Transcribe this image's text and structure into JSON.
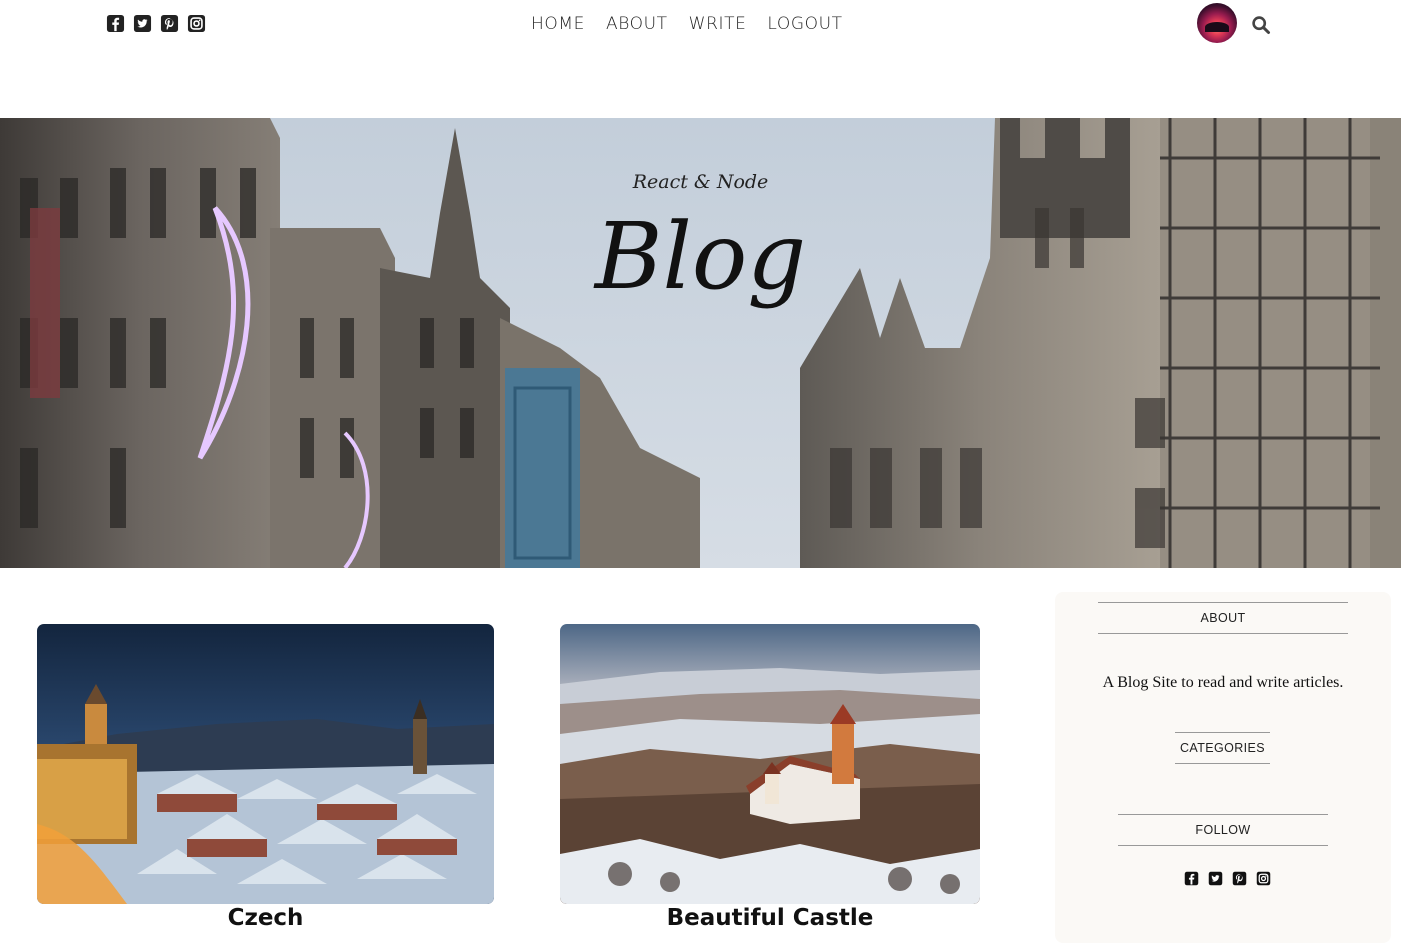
{
  "nav": {
    "items": [
      {
        "label": "HOME"
      },
      {
        "label": "ABOUT"
      },
      {
        "label": "WRITE"
      },
      {
        "label": "LOGOUT"
      }
    ],
    "social_icons": [
      "facebook-square-icon",
      "twitter-square-icon",
      "pinterest-square-icon",
      "instagram-icon"
    ],
    "search_icon": "search-icon"
  },
  "hero": {
    "subtitle": "React & Node",
    "title": "Blog"
  },
  "posts": [
    {
      "title": "Czech"
    },
    {
      "title": "Beautiful Castle"
    }
  ],
  "sidebar": {
    "about_title": "ABOUT",
    "about_text": "A Blog Site to read and write articles.",
    "categories_title": "CATEGORIES",
    "follow_title": "FOLLOW",
    "follow_icons": [
      "facebook-square-icon",
      "twitter-square-icon",
      "pinterest-square-icon",
      "instagram-icon"
    ]
  },
  "colors": {
    "text": "#111111",
    "sidebar_bg": "#fbf9f6",
    "divider": "#999999"
  }
}
